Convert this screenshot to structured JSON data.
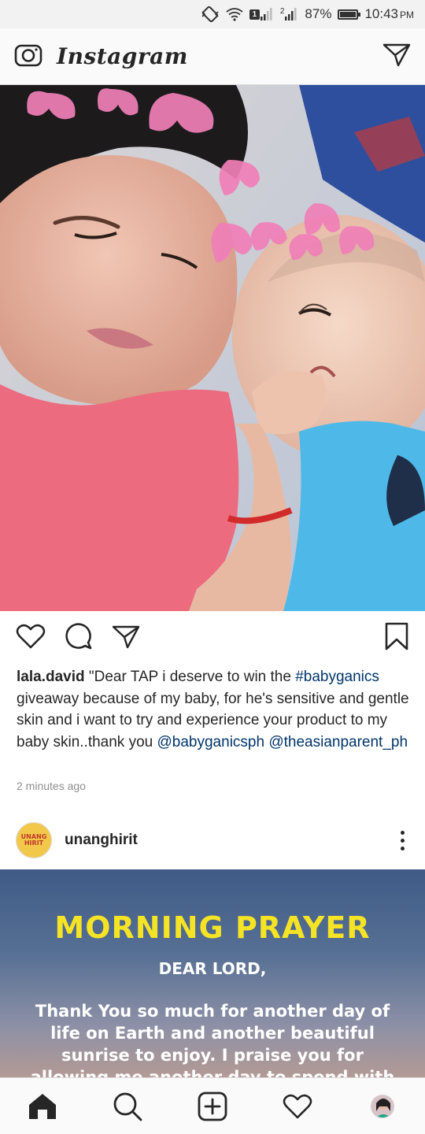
{
  "status_bar": {
    "sim_badge": "1",
    "signal2_label": "2",
    "battery": "87%",
    "battery_level": 0.87,
    "time": "10:43",
    "ampm": "PM"
  },
  "header": {
    "logo_text": "Instagram",
    "camera_icon": "camera-icon",
    "dm_icon": "paper-plane-icon"
  },
  "post1": {
    "image_icon": "photo",
    "actions": [
      "heart-icon",
      "comment-icon",
      "share-icon",
      "bookmark-icon"
    ],
    "caption": {
      "username": "lala.david",
      "text_1": " \"Dear TAP i deserve to win the ",
      "hashtag": "#babyganics",
      "text_2": " giveaway because of my baby, for he's sensitive and gentle skin and i want to try and experience your product to my baby skin..thank you ",
      "mention_1": "@babyganicsph",
      "text_3": " ",
      "mention_2": "@theasianparent_ph"
    },
    "timestamp": "2 minutes ago"
  },
  "post2": {
    "username": "unanghirit",
    "avatar_text": "UNANG HIRIT",
    "image": {
      "title": "MORNING PRAYER",
      "subtitle": "DEAR LORD,",
      "body": "Thank You so much for another day of life on Earth and another beautiful sunrise to enjoy. I praise you for allowing me another day to spend with my family. Please brush"
    }
  },
  "bottom_nav": {
    "items": [
      "home-icon",
      "search-icon",
      "add-post-icon",
      "activity-heart-icon",
      "profile-avatar"
    ]
  },
  "colors": {
    "link": "#003569",
    "muted": "#8e8e8e",
    "title_yellow": "#f5e326"
  }
}
